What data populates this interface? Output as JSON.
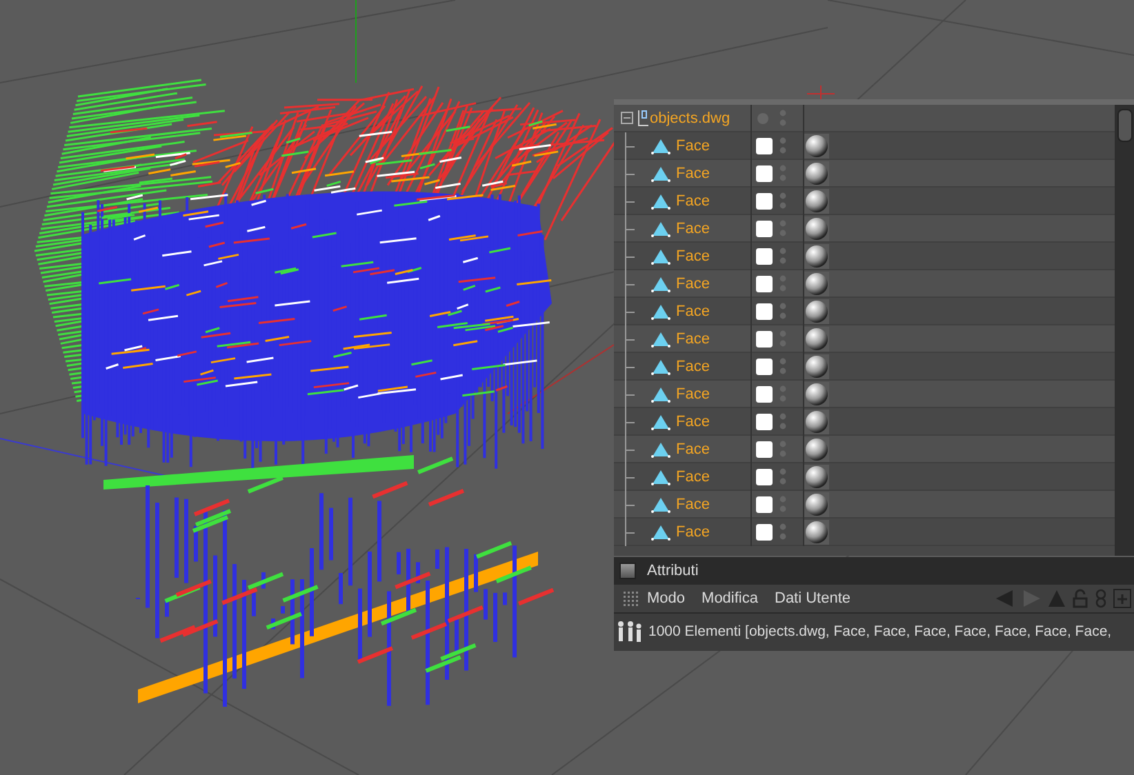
{
  "object_manager": {
    "root": {
      "name": "objects.dwg",
      "expanded": true,
      "children": [
        {
          "name": "Face"
        },
        {
          "name": "Face"
        },
        {
          "name": "Face"
        },
        {
          "name": "Face"
        },
        {
          "name": "Face"
        },
        {
          "name": "Face"
        },
        {
          "name": "Face"
        },
        {
          "name": "Face"
        },
        {
          "name": "Face"
        },
        {
          "name": "Face"
        },
        {
          "name": "Face"
        },
        {
          "name": "Face"
        },
        {
          "name": "Face"
        },
        {
          "name": "Face"
        },
        {
          "name": "Face"
        }
      ]
    }
  },
  "attributes": {
    "title": "Attributi",
    "menu": [
      "Modo",
      "Modifica",
      "Dati Utente"
    ],
    "status": "1000 Elementi [objects.dwg, Face, Face, Face, Face, Face, Face, Face,"
  }
}
